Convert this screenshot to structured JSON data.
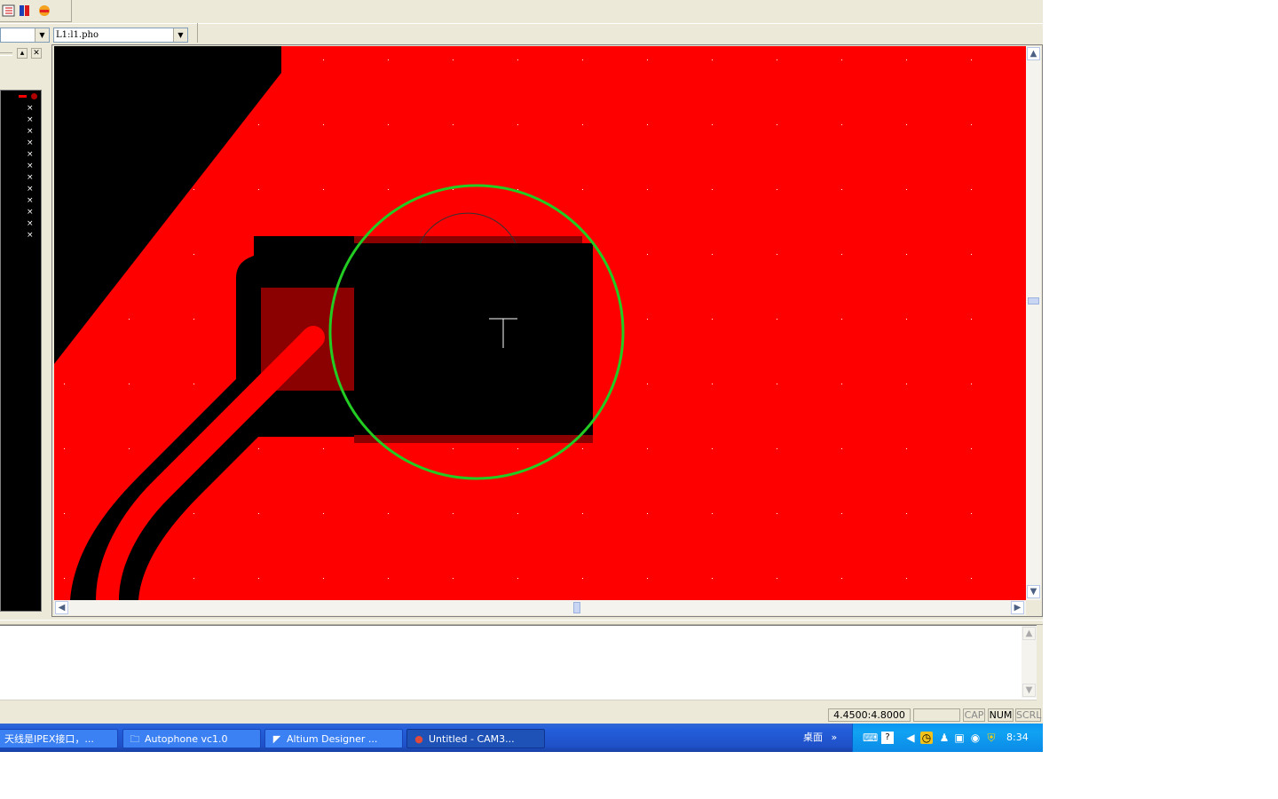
{
  "toolbar": {
    "icons": [
      "grid-icon",
      "layer-icon",
      "color-icon"
    ]
  },
  "combos": {
    "first_value": "",
    "layer_value": "L1:l1.pho"
  },
  "panel": {
    "layer_rows": [
      "×",
      "×",
      "×",
      "×",
      "×",
      "×",
      "×",
      "×",
      "×",
      "×",
      "×",
      "×"
    ]
  },
  "canvas": {
    "colors": {
      "copper": "#ff0000",
      "void": "#000000",
      "pad": "#8b0000",
      "highlight_circle": "#22cc22",
      "crosshair": "#ffffff"
    }
  },
  "status": {
    "coords": "4.4500:4.8000",
    "empty": "",
    "cap": "CAP",
    "num": "NUM",
    "scrl": "SCRL"
  },
  "taskbar": {
    "tasks": [
      {
        "label": "天线是IPEX接口，...",
        "icon": "document-icon"
      },
      {
        "label": "Autophone vc1.0",
        "icon": "folder-icon"
      },
      {
        "label": "Altium Designer ...",
        "icon": "altium-icon"
      },
      {
        "label": "Untitled - CAM3...",
        "icon": "cam-icon"
      }
    ],
    "desktop_label": "桌面",
    "more": "»",
    "clock": "8:34"
  }
}
